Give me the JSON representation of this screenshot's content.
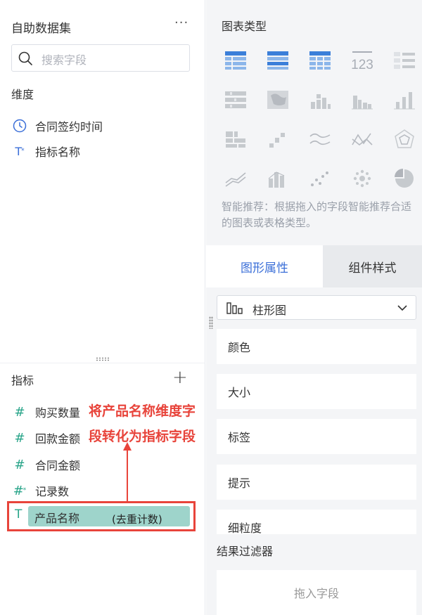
{
  "left_panel": {
    "title": "自助数据集",
    "more": "···",
    "search": {
      "placeholder": "搜索字段"
    },
    "dimension_title": "维度",
    "dimensions": [
      {
        "icon": "clock-icon",
        "label": "合同签约时间"
      },
      {
        "icon": "text-field-icon",
        "label": "指标名称"
      }
    ],
    "metric_title": "指标",
    "add": "+",
    "metrics": [
      {
        "icon": "#",
        "label": "购买数量"
      },
      {
        "icon": "#",
        "label": "回款金额"
      },
      {
        "icon": "#",
        "label": "合同金额"
      },
      {
        "icon": "#",
        "label": "记录数"
      }
    ],
    "dragged_field": {
      "icon": "T",
      "label": "产品名称",
      "suffix": "(去重计数)"
    }
  },
  "annotation": {
    "line1": "将产品名称维度字",
    "line2": "段转化为指标字段",
    "color": "#e8443b"
  },
  "right_panel": {
    "chart_type_title": "图表类型",
    "chart_icons": [
      "table-icon",
      "crosstable-icon",
      "detail-table-icon",
      "kpi-number-icon",
      "compare-table-icon",
      "heatmap-icon",
      "map-icon",
      "stacked-bar-icon",
      "grouped-bar-icon",
      "bar-icon",
      "treemap-icon",
      "waterfall-icon",
      "area-line-icon",
      "radar-line-icon",
      "radar-icon",
      "line-icon",
      "histogram-icon",
      "scatter-icon",
      "bubble-icon",
      "pie-icon"
    ],
    "kpi_text": "123",
    "hint": "智能推荐：根据拖入的字段智能推荐合适的图表或表格类型。",
    "tabs": {
      "active": "图形属性",
      "inactive": "组件样式"
    },
    "graph_type": {
      "icon": "bar-chart-icon",
      "label": "柱形图"
    },
    "properties": [
      "颜色",
      "大小",
      "标签",
      "提示",
      "细粒度"
    ],
    "result_filter": {
      "title": "结果过滤器",
      "drop_hint": "拖入字段"
    },
    "accent": "#3b6fd8"
  }
}
